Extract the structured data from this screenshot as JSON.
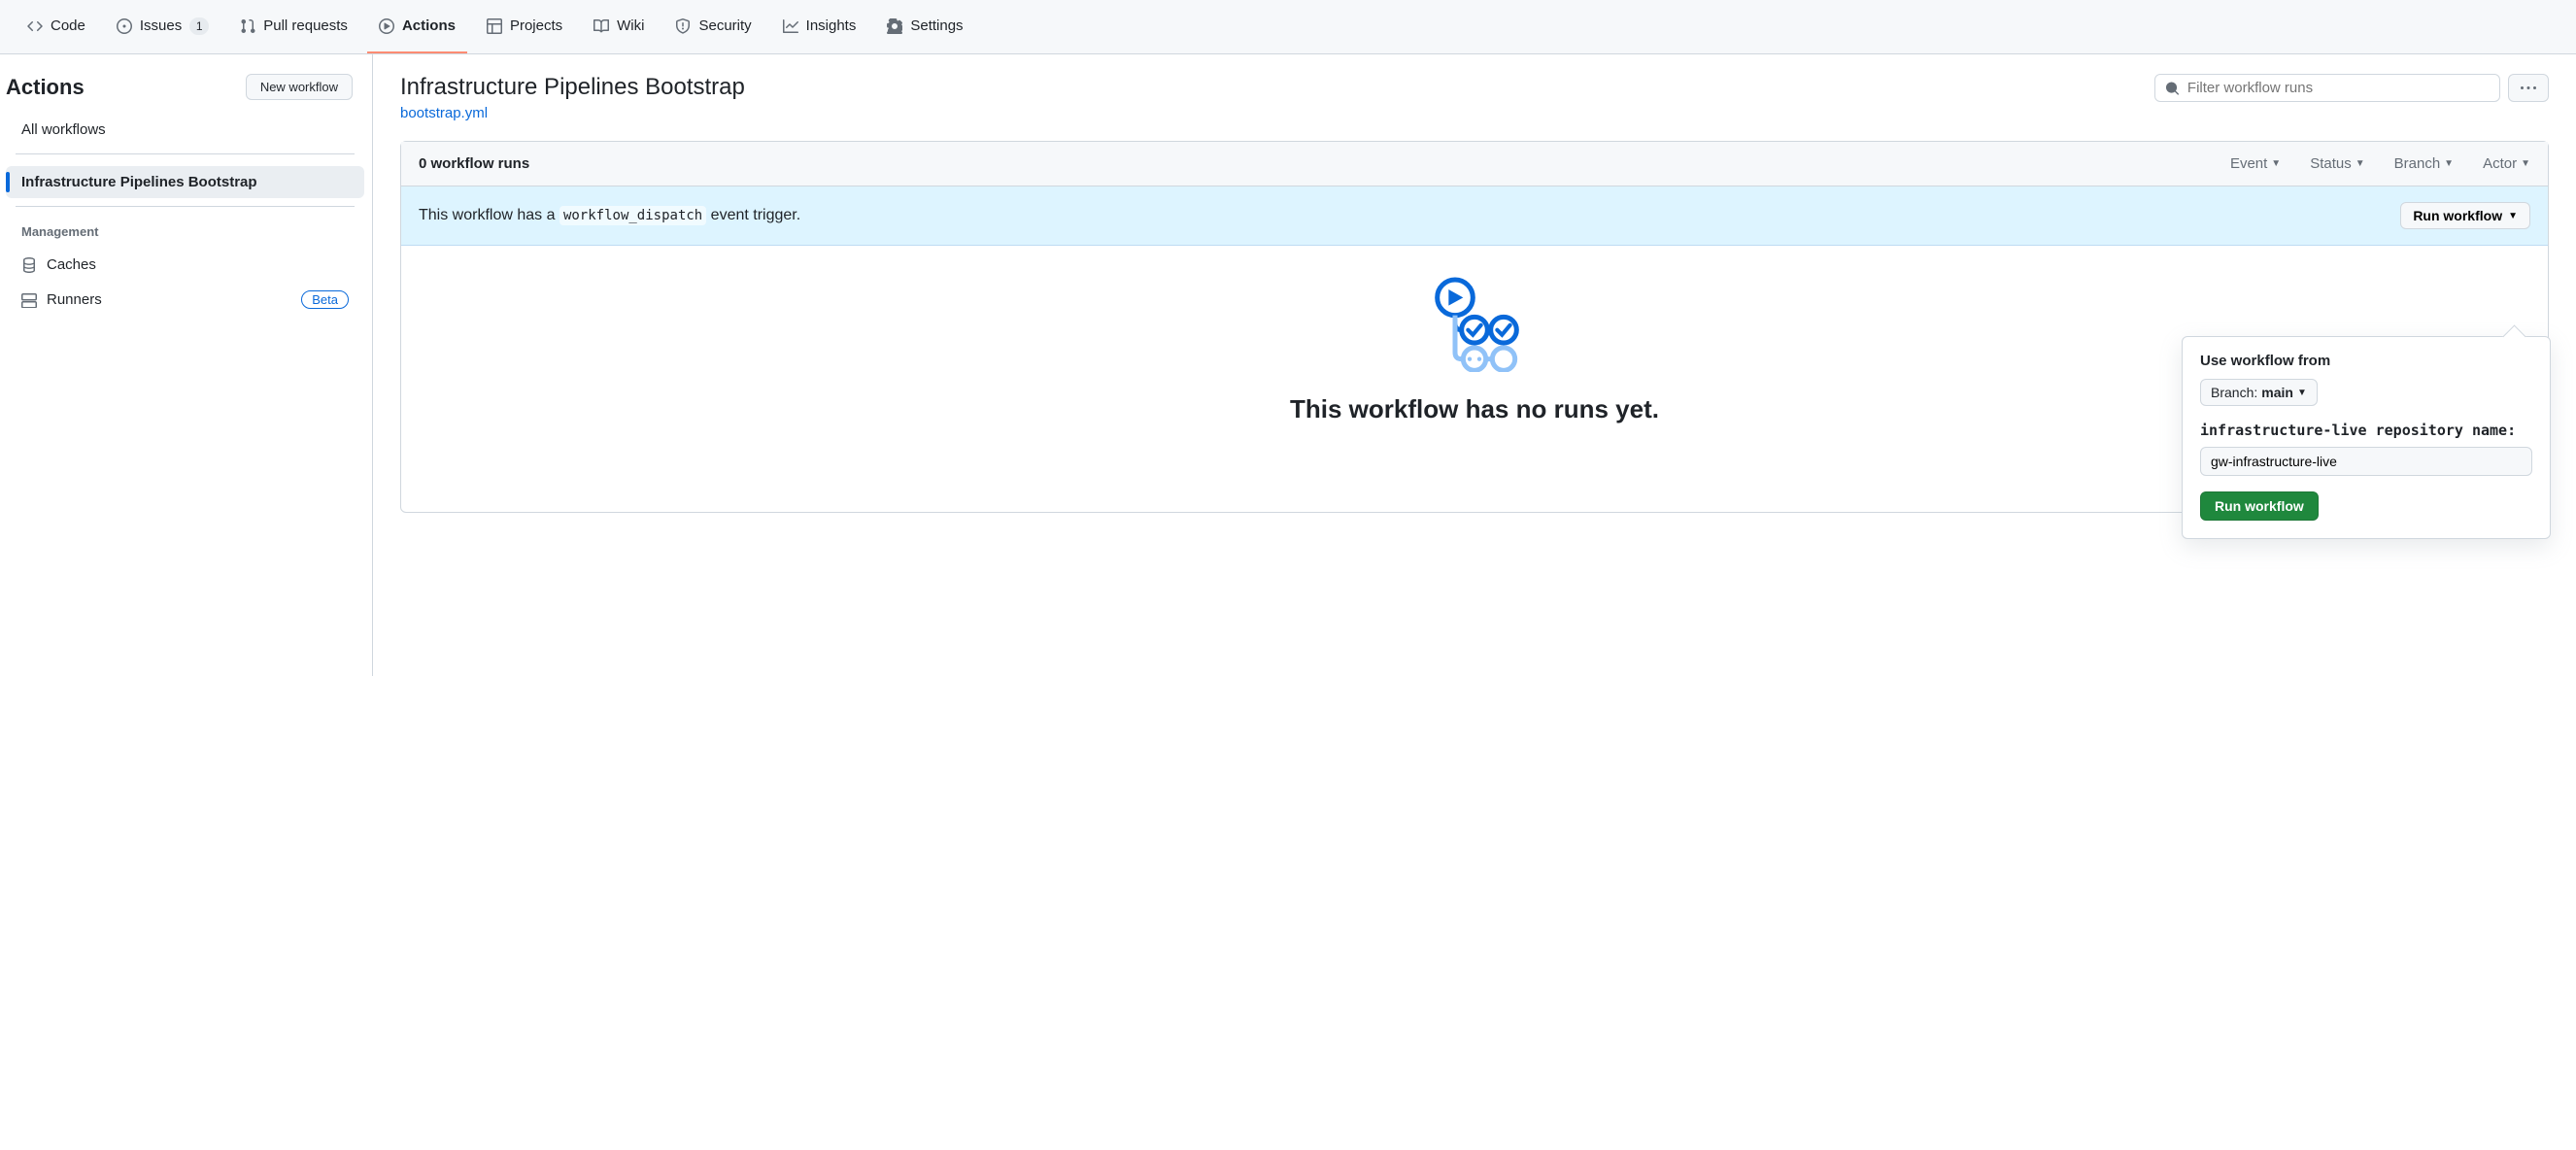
{
  "nav": {
    "items": [
      {
        "label": "Code"
      },
      {
        "label": "Issues",
        "count": "1"
      },
      {
        "label": "Pull requests"
      },
      {
        "label": "Actions"
      },
      {
        "label": "Projects"
      },
      {
        "label": "Wiki"
      },
      {
        "label": "Security"
      },
      {
        "label": "Insights"
      },
      {
        "label": "Settings"
      }
    ]
  },
  "sidebar": {
    "title": "Actions",
    "new_workflow_label": "New workflow",
    "all_workflows_label": "All workflows",
    "workflows": [
      {
        "label": "Infrastructure Pipelines Bootstrap"
      }
    ],
    "management_heading": "Management",
    "caches_label": "Caches",
    "runners_label": "Runners",
    "beta_label": "Beta"
  },
  "main": {
    "workflow_title": "Infrastructure Pipelines Bootstrap",
    "workflow_file": "bootstrap.yml",
    "search_placeholder": "Filter workflow runs",
    "runs_count": "0 workflow runs",
    "filters": {
      "event": "Event",
      "status": "Status",
      "branch": "Branch",
      "actor": "Actor"
    },
    "dispatch_text_prefix": "This workflow has a ",
    "dispatch_code": "workflow_dispatch",
    "dispatch_text_suffix": " event trigger.",
    "run_workflow_btn": "Run workflow",
    "empty_title": "This workflow has no runs yet."
  },
  "popover": {
    "use_from_label": "Use workflow from",
    "branch_prefix": "Branch: ",
    "branch_name": "main",
    "input_label": "infrastructure-live repository name:",
    "input_value": "gw-infrastructure-live",
    "submit_label": "Run workflow"
  }
}
